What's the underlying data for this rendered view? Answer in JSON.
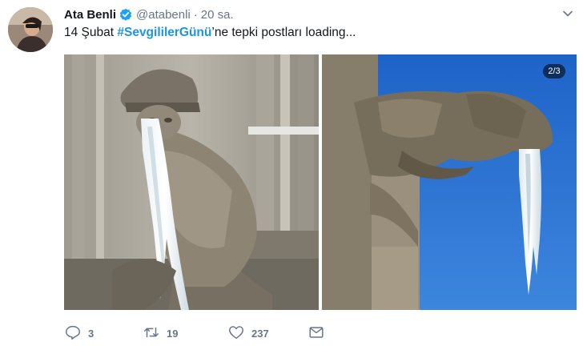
{
  "user": {
    "name": "Ata Benli",
    "handle": "@atabenli",
    "separator": "·",
    "time": "20 sa."
  },
  "tweet": {
    "text_before": "14 Şubat ",
    "hashtag": "#SevgililerGünü",
    "text_after": "’ne tepki postları loading..."
  },
  "media": {
    "badge": "2/3"
  },
  "actions": {
    "reply_count": "3",
    "retweet_count": "19",
    "like_count": "237"
  },
  "colors": {
    "hashtag": "#1b95e0",
    "verified": "#1da1f2",
    "secondary_text": "#657786"
  },
  "icons": [
    "verified-badge-icon",
    "chevron-down-icon",
    "reply-icon",
    "retweet-icon",
    "like-icon",
    "message-icon"
  ]
}
